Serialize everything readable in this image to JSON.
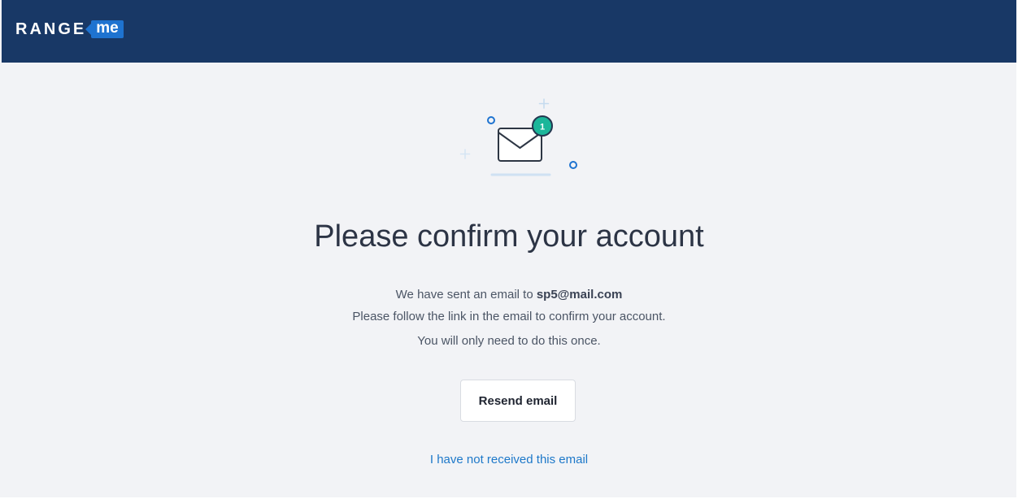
{
  "header": {
    "logo_text": "RANGE",
    "logo_badge": "me",
    "background_color": "#183866",
    "badge_color": "#1e73d0"
  },
  "illustration": {
    "icon": "envelope-notification-icon",
    "badge_count": "1",
    "badge_color": "#1bb69a"
  },
  "main": {
    "title": "Please confirm your account",
    "line1_prefix": "We have sent an email to",
    "email": "sp5@mail.com",
    "line2": "Please follow the link in the email to confirm your account.",
    "line3": "You will only need to do this once.",
    "resend_label": "Resend email",
    "not_received_link": "I have not received this email",
    "link_color": "#1d78c9"
  }
}
